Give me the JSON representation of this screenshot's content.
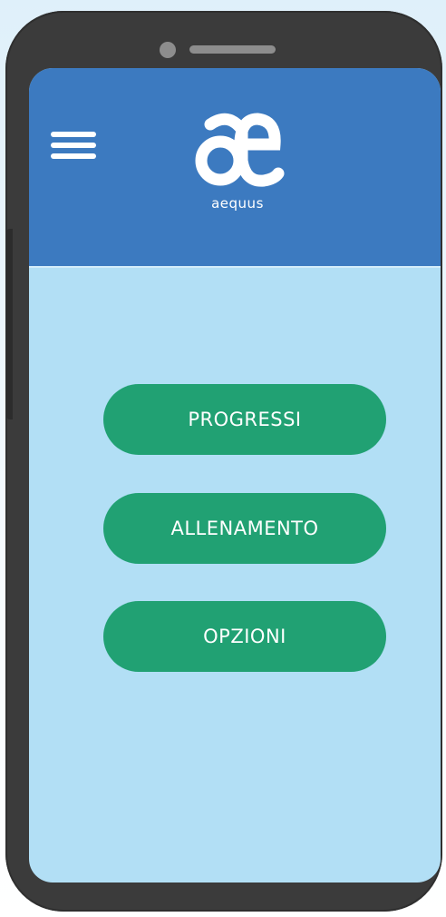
{
  "app": {
    "logo_text": "aequus",
    "logo_icon": "ae-ligature-logo",
    "menu_icon": "hamburger-menu-icon"
  },
  "main": {
    "buttons": [
      {
        "label": "PROGRESSI"
      },
      {
        "label": "ALLENAMENTO"
      },
      {
        "label": "OPZIONI"
      }
    ]
  },
  "colors": {
    "header": "#3c7ac0",
    "background": "#b2dff5",
    "button": "#21a173",
    "phone_body": "#3b3b3b"
  }
}
